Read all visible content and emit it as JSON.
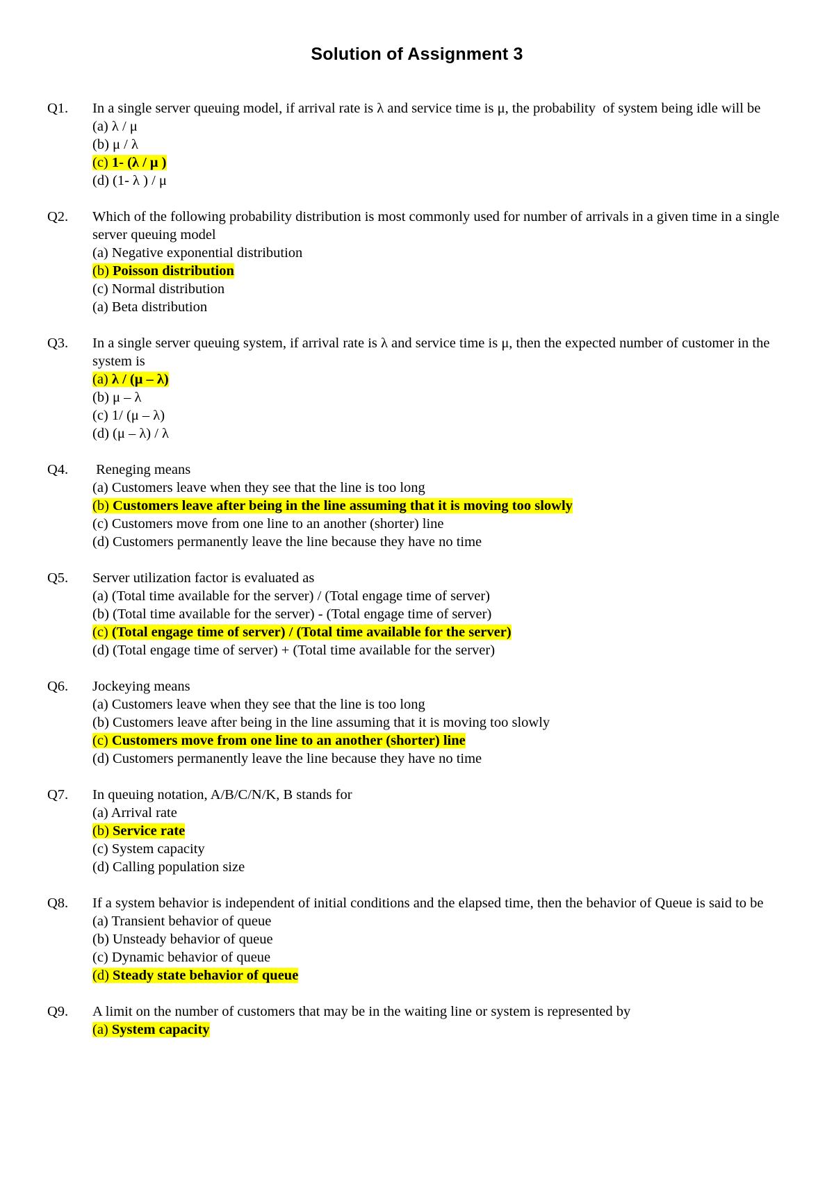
{
  "document": {
    "title": "Solution of Assignment 3",
    "highlight_color": "#ffff00",
    "text_color": "#000000",
    "background_color": "#ffffff"
  },
  "questions": [
    {
      "label": "Q1.",
      "stem": "In a single server queuing model, if arrival rate is λ and service time is μ, the probability  of system being idle will be",
      "options": [
        {
          "key": "(a)",
          "text": " λ / μ",
          "highlighted": false
        },
        {
          "key": "(b)",
          "text": " μ / λ",
          "highlighted": false
        },
        {
          "key": "(c)",
          "text": " 1- (λ / μ )",
          "highlighted": true
        },
        {
          "key": "(d)",
          "text": " (1- λ ) / μ",
          "highlighted": false
        }
      ]
    },
    {
      "label": "Q2.",
      "stem": "Which of the following probability distribution is most commonly used for number of arrivals in a given time in a single server queuing model",
      "options": [
        {
          "key": "(a)",
          "text": "  Negative exponential distribution",
          "highlighted": false
        },
        {
          "key": "(b)",
          "text": "  Poisson distribution",
          "highlighted": true
        },
        {
          "key": "(c)",
          "text": "  Normal distribution",
          "highlighted": false
        },
        {
          "key": "(a)",
          "text": "  Beta distribution",
          "highlighted": false
        }
      ]
    },
    {
      "label": "Q3.",
      "stem": "In a single server queuing system, if arrival rate is λ and service time is μ, then the expected number of customer in the system is",
      "options": [
        {
          "key": "(a)",
          "text": " λ / (μ – λ)",
          "highlighted": true
        },
        {
          "key": "(b)",
          "text": " μ – λ",
          "highlighted": false
        },
        {
          "key": "(c)",
          "text": " 1/ (μ – λ)",
          "highlighted": false
        },
        {
          "key": "(d)",
          "text": " (μ – λ) / λ",
          "highlighted": false
        }
      ]
    },
    {
      "label": "Q4.",
      "stem": " Reneging means",
      "options": [
        {
          "key": "(a)",
          "text": "  Customers leave when they see that the line is too long",
          "highlighted": false
        },
        {
          "key": "(b)",
          "text": "  Customers leave after being in the line assuming that it is moving too slowly",
          "highlighted": true
        },
        {
          "key": "(c)",
          "text": "  Customers move from one line to an another (shorter) line",
          "highlighted": false
        },
        {
          "key": "(d)",
          "text": "  Customers permanently leave the line because they have no time",
          "highlighted": false
        }
      ]
    },
    {
      "label": "Q5.",
      "stem": "Server utilization factor is evaluated as",
      "options": [
        {
          "key": "(a)",
          "text": "  (Total time available for the server) / (Total engage time of server)",
          "highlighted": false
        },
        {
          "key": "(b)",
          "text": "  (Total time available for the server) - (Total engage time of server)",
          "highlighted": false
        },
        {
          "key": "(c)",
          "text": "  (Total engage time of server) / (Total time available for the server)",
          "highlighted": true
        },
        {
          "key": "(d)",
          "text": "  (Total engage time of server) + (Total time available for the server)",
          "highlighted": false
        }
      ]
    },
    {
      "label": "Q6.",
      "stem": "Jockeying means",
      "options": [
        {
          "key": "(a)",
          "text": "  Customers leave when they see that the line is too long",
          "highlighted": false
        },
        {
          "key": "(b)",
          "text": "  Customers leave after being in the line assuming that it is moving too slowly",
          "highlighted": false
        },
        {
          "key": "(c)",
          "text": "  Customers move from one line to an another (shorter) line",
          "highlighted": true
        },
        {
          "key": "(d)",
          "text": "  Customers permanently leave the line because they have no time",
          "highlighted": false
        }
      ]
    },
    {
      "label": "Q7.",
      "stem": "In queuing notation, A/B/C/N/K, B stands for",
      "options": [
        {
          "key": "(a)",
          "text": "  Arrival rate",
          "highlighted": false
        },
        {
          "key": "(b)",
          "text": "  Service rate",
          "highlighted": true
        },
        {
          "key": "(c)",
          "text": "  System capacity",
          "highlighted": false
        },
        {
          "key": "(d)",
          "text": "  Calling population size",
          "highlighted": false
        }
      ]
    },
    {
      "label": "Q8.",
      "stem": "If a system behavior is independent of initial conditions and the elapsed time, then the behavior of Queue is said to be",
      "options": [
        {
          "key": "(a)",
          "text": "  Transient behavior of queue",
          "highlighted": false
        },
        {
          "key": "(b)",
          "text": "  Unsteady behavior of queue",
          "highlighted": false
        },
        {
          "key": "(c)",
          "text": "  Dynamic behavior of queue",
          "highlighted": false
        },
        {
          "key": "(d)",
          "text": "  Steady state behavior of queue",
          "highlighted": true
        }
      ]
    },
    {
      "label": "Q9.",
      "stem": "A limit on the number of customers that may be in the waiting line or system is represented by",
      "options": [
        {
          "key": "(a)",
          "text": "  System capacity",
          "highlighted": true
        }
      ]
    }
  ]
}
